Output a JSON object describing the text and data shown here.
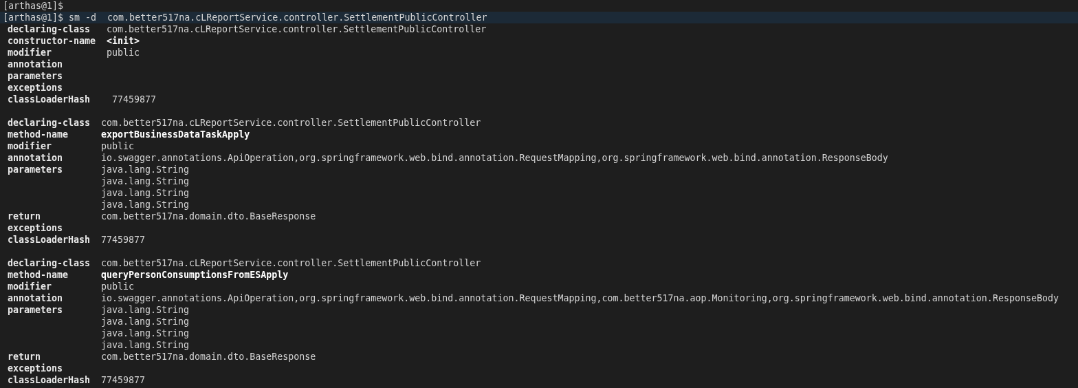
{
  "previous_prompt": "[arthas@1]$",
  "prompt": {
    "text": "[arthas@1]$ sm -d  com.better517na.cLReportService.controller.SettlementPublicController"
  },
  "blocks": [
    {
      "kind": "constructor",
      "fields": [
        {
          "kind": "attribute",
          "key": "declaring-class",
          "values": [
            "com.better517na.cLReportService.controller.SettlementPublicController"
          ]
        },
        {
          "kind": "name",
          "key": "constructor-name",
          "values": [
            "<init>"
          ]
        },
        {
          "kind": "attribute",
          "key": "modifier",
          "values": [
            "public"
          ]
        },
        {
          "kind": "attribute",
          "key": "annotation"
        },
        {
          "kind": "attribute",
          "key": "parameters"
        },
        {
          "kind": "attribute",
          "key": "exceptions"
        },
        {
          "kind": "attribute",
          "key": "classLoaderHash",
          "values": [
            " 77459877"
          ]
        }
      ]
    },
    {
      "kind": "method",
      "fields": [
        {
          "kind": "attribute",
          "key": "declaring-class",
          "values": [
            "com.better517na.cLReportService.controller.SettlementPublicController"
          ]
        },
        {
          "kind": "name",
          "key": "method-name",
          "values": [
            "exportBusinessDataTaskApply"
          ]
        },
        {
          "kind": "attribute",
          "key": "modifier",
          "values": [
            "public"
          ]
        },
        {
          "kind": "attribute",
          "key": "annotation",
          "values": [
            "io.swagger.annotations.ApiOperation,org.springframework.web.bind.annotation.RequestMapping,org.springframework.web.bind.annotation.ResponseBody"
          ]
        },
        {
          "kind": "attribute",
          "key": "parameters",
          "values": [
            "java.lang.String",
            "java.lang.String",
            "java.lang.String",
            "java.lang.String"
          ]
        },
        {
          "kind": "attribute",
          "key": "return",
          "values": [
            "com.better517na.domain.dto.BaseResponse"
          ]
        },
        {
          "kind": "attribute",
          "key": "exceptions"
        },
        {
          "kind": "attribute",
          "key": "classLoaderHash",
          "values": [
            "77459877"
          ]
        }
      ]
    },
    {
      "kind": "method",
      "fields": [
        {
          "kind": "attribute",
          "key": "declaring-class",
          "values": [
            "com.better517na.cLReportService.controller.SettlementPublicController"
          ]
        },
        {
          "kind": "name",
          "key": "method-name",
          "values": [
            "queryPersonConsumptionsFromESApply"
          ]
        },
        {
          "kind": "attribute",
          "key": "modifier",
          "values": [
            "public"
          ]
        },
        {
          "kind": "attribute",
          "key": "annotation",
          "values": [
            "io.swagger.annotations.ApiOperation,org.springframework.web.bind.annotation.RequestMapping,com.better517na.aop.Monitoring,org.springframework.web.bind.annotation.ResponseBody"
          ]
        },
        {
          "kind": "attribute",
          "key": "parameters",
          "values": [
            "java.lang.String",
            "java.lang.String",
            "java.lang.String",
            "java.lang.String"
          ]
        },
        {
          "kind": "attribute",
          "key": "return",
          "values": [
            "com.better517na.domain.dto.BaseResponse"
          ]
        },
        {
          "kind": "attribute",
          "key": "exceptions"
        },
        {
          "kind": "attribute",
          "key": "classLoaderHash",
          "values": [
            "77459877"
          ]
        }
      ]
    }
  ]
}
